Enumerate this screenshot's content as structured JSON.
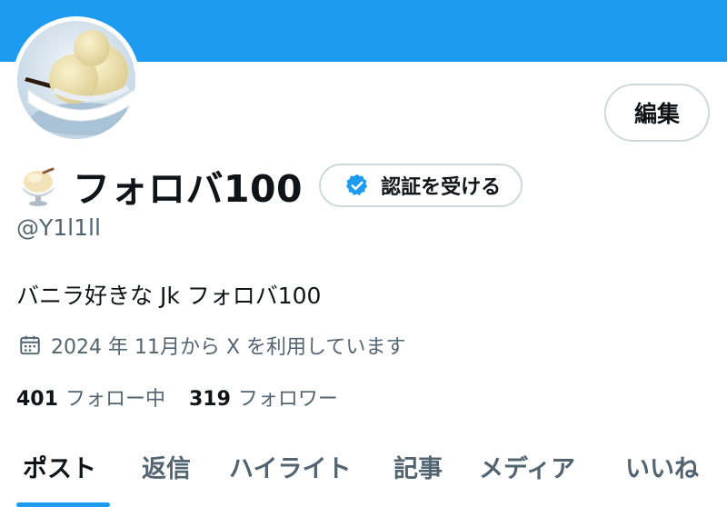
{
  "profile": {
    "display_name": "フォロバ100",
    "handle": "@Y1l1ll",
    "bio": "バニラ好きな Jk フォロバ100",
    "joined": "2024 年 11月から X を利用しています"
  },
  "buttons": {
    "edit_label": "編集",
    "verify_label": "認証を受ける"
  },
  "stats": {
    "following_count": "401",
    "following_label": "フォロー中",
    "followers_count": "319",
    "followers_label": "フォロワー"
  },
  "tabs": [
    {
      "label": "ポスト",
      "active": true
    },
    {
      "label": "返信"
    },
    {
      "label": "ハイライト"
    },
    {
      "label": "記事"
    },
    {
      "label": "メディア"
    },
    {
      "label": "いいね"
    }
  ],
  "icons": {
    "name_emoji": "shaved-ice-icon",
    "verify": "verified-badge-icon",
    "joined": "calendar-icon"
  },
  "colors": {
    "accent": "#1d9bf0",
    "text_primary": "#0f1419",
    "text_secondary": "#536471",
    "border": "#cfd9de"
  }
}
